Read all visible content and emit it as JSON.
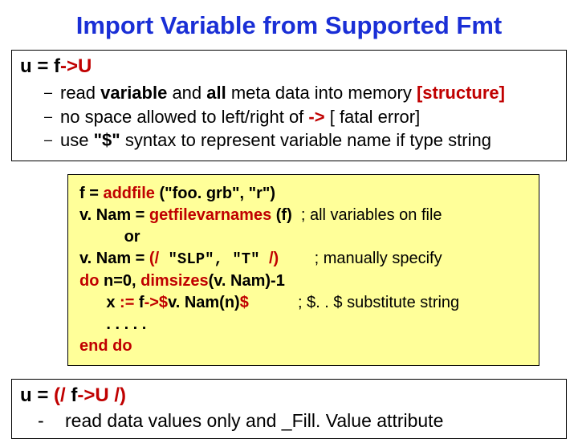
{
  "title": "Import Variable from Supported Fmt",
  "box1": {
    "lhs": "u = ",
    "f": "f",
    "arrow": "->U",
    "b1_pre": "read ",
    "b1_var": "variable",
    "b1_mid": " and ",
    "b1_all": "all",
    "b1_post": " meta data into memory ",
    "b1_struct": "[structure]",
    "b2_pre": "no space allowed to left/right of   ",
    "b2_arrow": "->",
    "b2_post": "        [ fatal error]",
    "b3_pre": "use ",
    "b3_q": "\"$\"",
    "b3_post": " syntax to represent variable name if type string"
  },
  "code": {
    "l1a": "f = ",
    "l1b": "addfile",
    "l1c": " (\"foo. grb\", \"r\")",
    "l2a": "v. Nam = ",
    "l2b": "getfilevarnames",
    "l2c": " (f)  ",
    "l2d": "; all variables on file",
    "l3": "          or",
    "l4a": "v. Nam = ",
    "l4b": "(/",
    "l4c": " \"SLP\", \"T\" ",
    "l4d": "/)",
    "l4e": "        ; manually specify",
    "l5a": "do",
    "l5b": " n=0, ",
    "l5c": "dimsizes",
    "l5d": "(v. Nam)-1",
    "l6a": "      x ",
    "l6b": ":=",
    "l6c": " f",
    "l6d": "->$",
    "l6e": "v. Nam(n)",
    "l6f": "$",
    "l6g": "           ; $. . $ substitute string",
    "l7": "      . . . . .",
    "l8": "end do"
  },
  "box2": {
    "lhs": "u = ",
    "open": "(/",
    "mid": " f",
    "arrow": "->U ",
    "close": "/)",
    "sub_dash": "-",
    "sub_text": "read data values only and _Fill. Value attribute"
  }
}
